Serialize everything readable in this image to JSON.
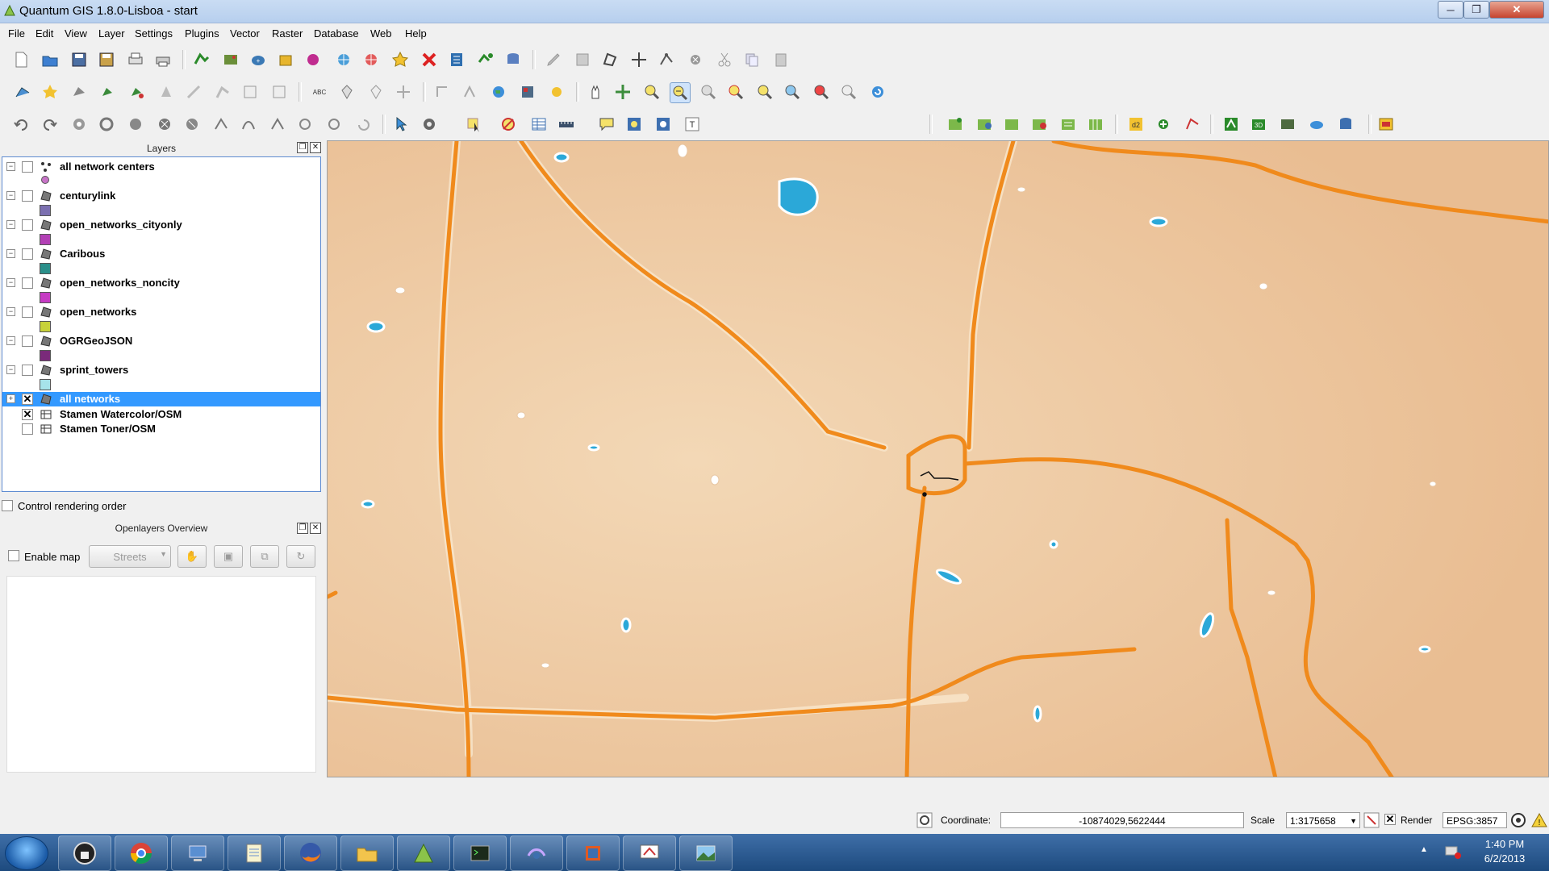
{
  "window": {
    "title": "Quantum GIS 1.8.0-Lisboa - start",
    "controls": {
      "minimize": "─",
      "maximize": "❐",
      "close": "✕"
    }
  },
  "menubar": {
    "items": [
      "File",
      "Edit",
      "View",
      "Layer",
      "Settings",
      "Plugins",
      "Vector",
      "Raster",
      "Database",
      "Web",
      "Help"
    ]
  },
  "layers_panel": {
    "title": "Layers",
    "layers": [
      {
        "name": "all network centers",
        "checked": false,
        "selected": false,
        "symbol": "point",
        "swatch": "#c774c7"
      },
      {
        "name": "centurylink",
        "checked": false,
        "selected": false,
        "symbol": "polygon",
        "swatch": "#7b6fb0"
      },
      {
        "name": "open_networks_cityonly",
        "checked": false,
        "selected": false,
        "symbol": "polygon",
        "swatch": "#b23fb5"
      },
      {
        "name": "Caribous",
        "checked": false,
        "selected": false,
        "symbol": "polygon",
        "swatch": "#2a8f8a"
      },
      {
        "name": "open_networks_noncity",
        "checked": false,
        "selected": false,
        "symbol": "polygon",
        "swatch": "#c63bc4"
      },
      {
        "name": "open_networks",
        "checked": false,
        "selected": false,
        "symbol": "polygon",
        "swatch": "#c8d23a"
      },
      {
        "name": "OGRGeoJSON",
        "checked": false,
        "selected": false,
        "symbol": "polygon",
        "swatch": "#7a2a7a"
      },
      {
        "name": "sprint_towers",
        "checked": false,
        "selected": false,
        "symbol": "polygon",
        "swatch": "#a6e3ea"
      },
      {
        "name": "all networks",
        "checked": true,
        "selected": true,
        "symbol": "polygon",
        "swatch": null
      },
      {
        "name": "Stamen Watercolor/OSM",
        "checked": true,
        "selected": false,
        "symbol": "raster",
        "swatch": null
      },
      {
        "name": "Stamen Toner/OSM",
        "checked": false,
        "selected": false,
        "symbol": "raster",
        "swatch": null
      }
    ],
    "control_rendering_order": "Control rendering order"
  },
  "openlayers_overview": {
    "title": "Openlayers Overview",
    "enable_map": "Enable map",
    "layer_select": "Streets"
  },
  "statusbar": {
    "coordinate_label": "Coordinate:",
    "coordinate_value": "-10874029,5622444",
    "scale_label": "Scale",
    "scale_value": "1:3175658",
    "render_label": "Render",
    "crs": "EPSG:3857"
  },
  "taskbar": {
    "apps": [
      "lock-app",
      "chrome",
      "network-app",
      "notepad",
      "firefox",
      "file-explorer",
      "qgis",
      "terminal",
      "mesh-app",
      "office-app",
      "presentation-app",
      "photo-app"
    ],
    "clock_time": "1:40 PM",
    "clock_date": "6/2/2013"
  },
  "colors": {
    "accent_selection": "#3399ff",
    "map_background": "#efcaa0",
    "roads": "#f08a1c",
    "water": "#2aa9d8"
  }
}
